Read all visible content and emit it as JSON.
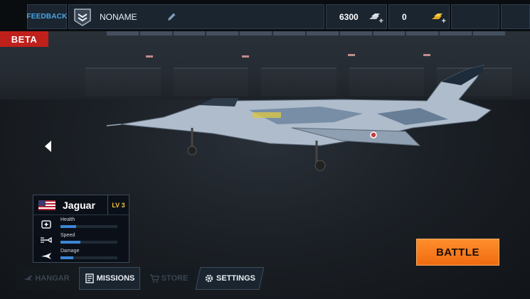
{
  "topbar": {
    "feedback_label": "FEEDBACK",
    "player_name": "NONAME",
    "silver_amount": "6300",
    "gold_amount": "0"
  },
  "badge": {
    "beta_label": "BETA"
  },
  "aircraft_card": {
    "name": "Jaguar",
    "level": "LV 3",
    "flag": "us-flag",
    "stats": [
      {
        "label": "Health",
        "icon": "health-icon",
        "value": 0.28
      },
      {
        "label": "Speed",
        "icon": "speed-icon",
        "value": 0.35
      },
      {
        "label": "Damage",
        "icon": "damage-icon",
        "value": 0.22
      }
    ]
  },
  "bottom_nav": {
    "hangar_label": "HANGAR",
    "missions_label": "MISSIONS",
    "store_label": "STORE",
    "settings_label": "SETTINGS"
  },
  "battle_label": "BATTLE",
  "colors": {
    "accent_blue": "#4aa7e6",
    "beta_red": "#c0201b",
    "battle_orange": "#f57a1a",
    "level_gold": "#f2c23a",
    "stat_bar": "#3c86d6"
  }
}
